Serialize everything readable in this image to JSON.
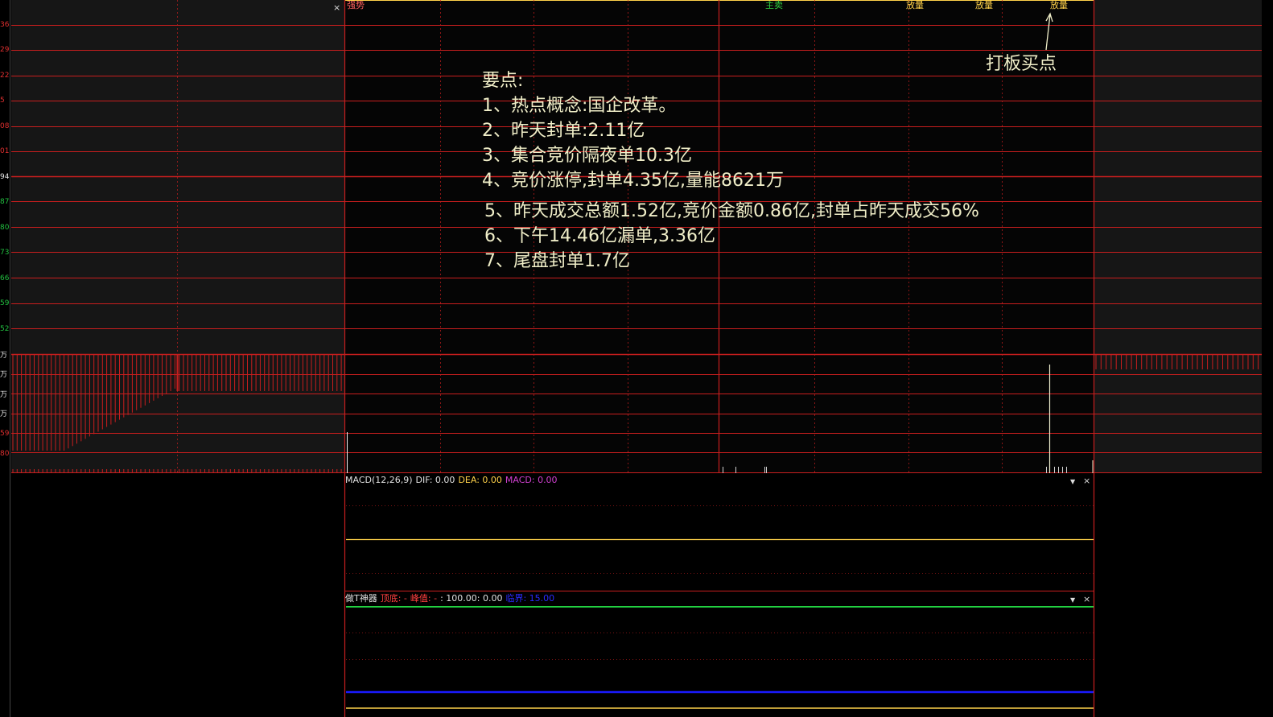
{
  "y_axis_labels": [
    "36",
    "29",
    "22",
    "5",
    "08",
    "01",
    "94",
    "87",
    "80",
    "73",
    "66",
    "59",
    "52"
  ],
  "vol_axis_labels": [
    "万",
    "万",
    "万",
    "万",
    "59",
    "80"
  ],
  "event_tags": [
    {
      "text": "强势",
      "color": "#ff6060"
    },
    {
      "text": "主卖",
      "color": "#30d040"
    },
    {
      "text": "放量",
      "color": "#ffd24a"
    },
    {
      "text": "放量",
      "color": "#ffd24a"
    },
    {
      "text": "放量",
      "color": "#ffd24a"
    }
  ],
  "annotation": {
    "buy_point": "打板买点",
    "heading": "要点:",
    "points": [
      "1、热点概念:国企改革。",
      "2、昨天封单:2.11亿",
      "3、集合竞价隔夜单10.3亿",
      "4、竞价涨停,封单4.35亿,量能8621万",
      "5、昨天成交总额1.52亿,竞价金额0.86亿,封单占昨天成交56%",
      "6、下午14.46亿漏单,3.36亿",
      "7、尾盘封单1.7亿"
    ]
  },
  "macd": {
    "name": "MACD(12,26,9)",
    "dif": "DIF: 0.00",
    "dea": "DEA: 0.00",
    "macd": "MACD: 0.00"
  },
  "t_tool": {
    "name": "做T神器",
    "a": "顶底: -",
    "b": "峰值: -",
    "c": ": 100.00",
    "d": ": 0.00",
    "e": "临界: 15.00"
  },
  "controls": {
    "close_x": "×",
    "menu_arrow": "▼"
  },
  "colors": {
    "grid": "#c81e1e",
    "price_line": "#ffd24a",
    "green_line": "#22d040",
    "blue_line": "#1a1aff",
    "note_text": "#f0eec8"
  }
}
